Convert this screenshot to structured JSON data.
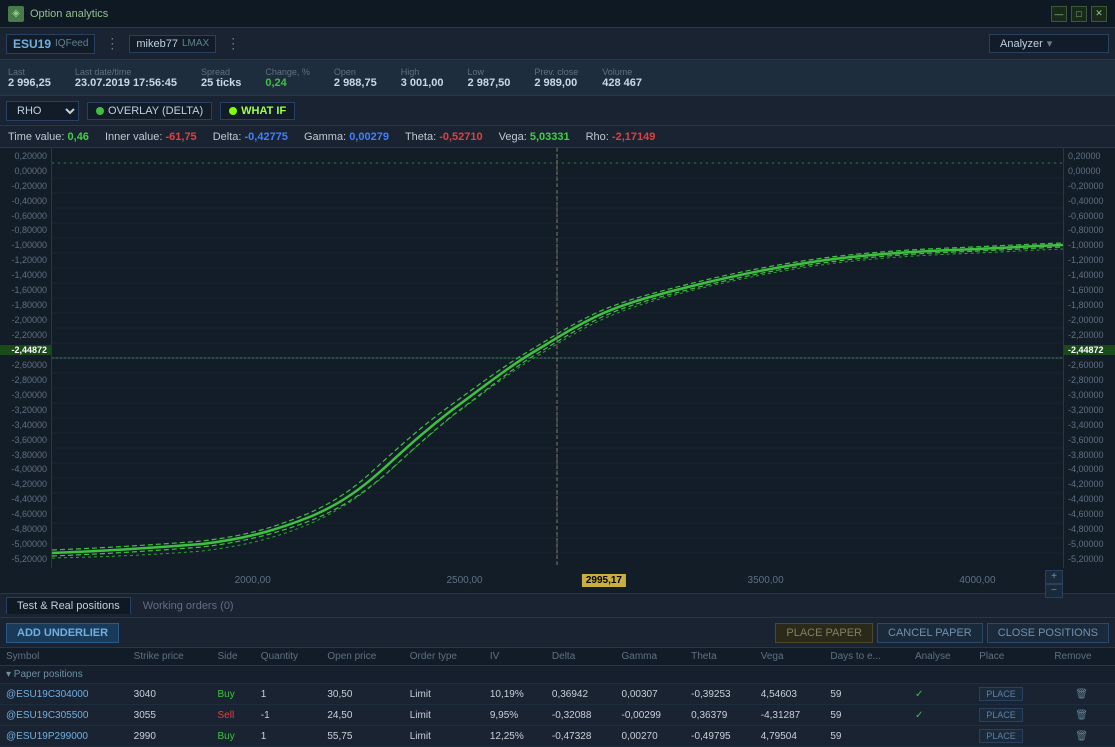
{
  "app": {
    "title": "Option analytics"
  },
  "header": {
    "symbol": "ESU19",
    "feed": "IQFeed",
    "account": "mikeb77",
    "broker": "LMAX",
    "analyzer_label": "Analyzer"
  },
  "stats": {
    "last_label": "Last",
    "last_value": "2 996,25",
    "datetime_label": "Last date/time",
    "datetime_value": "23.07.2019 17:56:45",
    "spread_label": "Spread",
    "spread_value": "25 ticks",
    "change_label": "Change, %",
    "change_value": "0,24",
    "open_label": "Open",
    "open_value": "2 988,75",
    "high_label": "High",
    "high_value": "3 001,00",
    "low_label": "Low",
    "low_value": "2 987,50",
    "prev_close_label": "Prev. close",
    "prev_close_value": "2 989,00",
    "volume_label": "Volume",
    "volume_value": "428 467"
  },
  "controls": {
    "rho_label": "RHO",
    "overlay_label": "OVERLAY (DELTA)",
    "whatif_label": "WHAT IF"
  },
  "greeks": {
    "time_value_label": "Time value:",
    "time_value": "0,46",
    "inner_value_label": "Inner value:",
    "inner_value": "-61,75",
    "delta_label": "Delta:",
    "delta_value": "-0,42775",
    "gamma_label": "Gamma:",
    "gamma_value": "0,00279",
    "theta_label": "Theta:",
    "theta_value": "-0,52710",
    "vega_label": "Vega:",
    "vega_value": "5,03331",
    "rho_label": "Rho:",
    "rho_value": "-2,17149"
  },
  "chart": {
    "y_labels_left": [
      "0,20000",
      "0,00000",
      "-0,20000",
      "-0,40000",
      "-0,60000",
      "-0,80000",
      "-1,00000",
      "-1,20000",
      "-1,40000",
      "-1,60000",
      "-1,80000",
      "-2,00000",
      "-2,20000",
      "-2,44872",
      "-2,60000",
      "-2,80000",
      "-3,00000",
      "-3,20000",
      "-3,40000",
      "-3,60000",
      "-3,80000",
      "-4,00000",
      "-4,20000",
      "-4,40000",
      "-4,60000",
      "-4,80000",
      "-5,00000",
      "-5,20000"
    ],
    "y_highlight": "-2,44872",
    "x_labels": [
      "2000,00",
      "2500,00",
      "3500,00",
      "4000,00"
    ],
    "price_tag": "2995,17"
  },
  "bottom": {
    "tab1_label": "Test & Real positions",
    "tab2_label": "Working orders (0)",
    "add_underlier_label": "ADD UNDERLIER",
    "place_paper_label": "PLACE PAPER",
    "cancel_paper_label": "CANCEL PAPER",
    "close_positions_label": "CLOSE POSITIONS",
    "table_headers": [
      "Symbol",
      "Strike price",
      "Side",
      "Quantity",
      "Open price",
      "Order type",
      "IV",
      "Delta",
      "Gamma",
      "Theta",
      "Vega",
      "Days to e...",
      "Analyse",
      "Place",
      "Remove"
    ],
    "section_label": "▾ Paper positions",
    "rows": [
      {
        "symbol": "@ESU19C304000",
        "strike": "3040",
        "side": "Buy",
        "quantity": "1",
        "open_price": "30,50",
        "order_type": "Limit",
        "iv": "10,19%",
        "delta": "0,36942",
        "gamma": "0,00307",
        "theta": "-0,39253",
        "vega": "4,54603",
        "days": "59",
        "analyse": "✓",
        "place": "PLACE",
        "remove": "🗑"
      },
      {
        "symbol": "@ESU19C305500",
        "strike": "3055",
        "side": "Sell",
        "quantity": "-1",
        "open_price": "24,50",
        "order_type": "Limit",
        "iv": "9,95%",
        "delta": "-0,32088",
        "gamma": "-0,00299",
        "theta": "0,36379",
        "vega": "-4,31287",
        "days": "59",
        "analyse": "✓",
        "place": "PLACE",
        "remove": "🗑"
      },
      {
        "symbol": "@ESU19P299000",
        "strike": "2990",
        "side": "Buy",
        "quantity": "1",
        "open_price": "55,75",
        "order_type": "Limit",
        "iv": "12,25%",
        "delta": "-0,47328",
        "gamma": "0,00270",
        "theta": "-0,49795",
        "vega": "4,79504",
        "days": "59",
        "analyse": "",
        "place": "PLACE",
        "remove": "🗑"
      }
    ]
  },
  "colors": {
    "accent_green": "#40c040",
    "accent_lime": "#80ff00",
    "accent_red": "#e04040",
    "accent_blue": "#4080ff",
    "accent_orange": "#ff8040",
    "bg_dark": "#131d28",
    "bg_mid": "#1a2332",
    "bg_light": "#1e2d3d",
    "highlight_yellow": "#c8b040"
  }
}
